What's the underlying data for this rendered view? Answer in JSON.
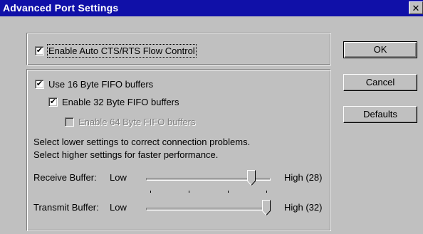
{
  "window": {
    "title": "Advanced Port Settings",
    "close_glyph": "✕"
  },
  "flow_control": {
    "label": "Enable Auto CTS/RTS Flow Control",
    "checked": true
  },
  "fifo": {
    "use16": {
      "label": "Use 16 Byte FIFO buffers",
      "checked": true
    },
    "enable32": {
      "label": "Enable 32 Byte FIFO buffers",
      "checked": true
    },
    "enable64": {
      "label": "Enable 64 Byte FIFO buffers",
      "checked": false,
      "disabled": true
    }
  },
  "hint": {
    "line1": "Select lower settings to correct connection problems.",
    "line2": "Select higher settings for faster performance."
  },
  "receive_buffer": {
    "label": "Receive Buffer:",
    "low_label": "Low",
    "high_label": "High (28)",
    "value": 28,
    "min": 1,
    "max": 32
  },
  "transmit_buffer": {
    "label": "Transmit Buffer:",
    "low_label": "Low",
    "high_label": "High (32)",
    "value": 32,
    "min": 1,
    "max": 32
  },
  "buttons": {
    "ok": "OK",
    "cancel": "Cancel",
    "defaults": "Defaults"
  },
  "check_glyph": "✔",
  "colors": {
    "titlebar": "#1010a8",
    "face": "#c0c0c0"
  }
}
